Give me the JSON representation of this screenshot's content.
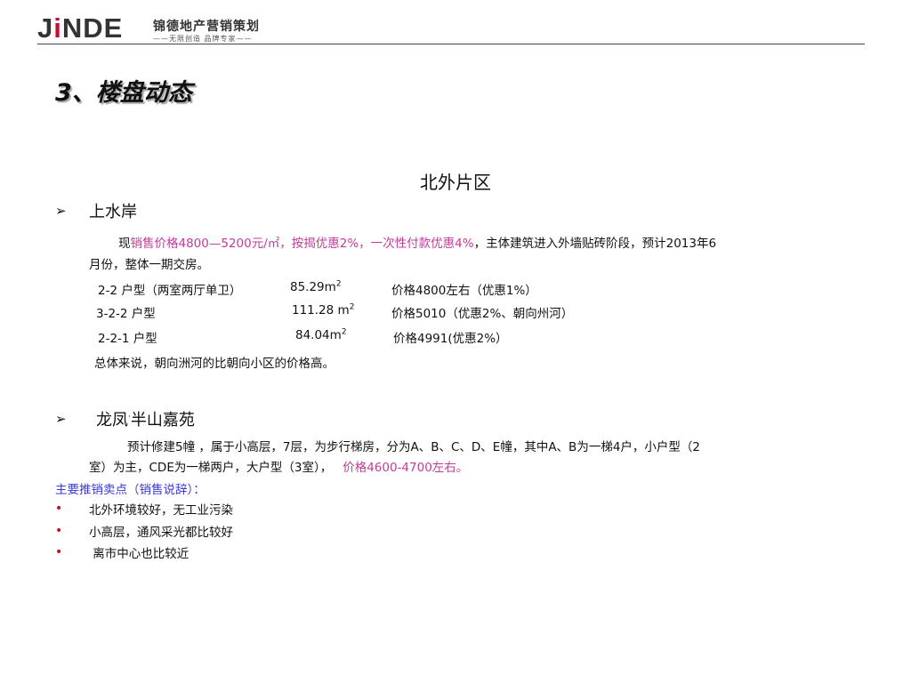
{
  "header": {
    "logo_mark": "JiNDE",
    "logo_cn": "锦德地产营销策划",
    "logo_sub": "——无限创造  品牌专家——"
  },
  "title": "3、楼盘动态",
  "section_heading": "北外片区",
  "project1": {
    "arrow": "➢",
    "name": "上水岸",
    "desc_prefix": "现",
    "desc_highlight": "销售价格4800—5200元/㎡，按揭优惠2%，一次性付款优惠4%",
    "desc_rest_line1": "，主体建筑进入外墙贴砖阶段，预计2013年6",
    "desc_line2": "月份，整体一期交房。",
    "units": [
      {
        "type": "2-2  户型（两室两厅单卫）",
        "area": "85.29m",
        "price": "价格4800左右（优惠1%）"
      },
      {
        "type": "3-2-2 户型",
        "area": "111.28 m",
        "price": "价格5010（优惠2%、朝向州河）"
      },
      {
        "type": "2-2-1 户型",
        "area": "84.04m",
        "price": "价格4991(优惠2%）"
      }
    ],
    "area_sup": "2",
    "summary": "总体来说，朝向洲河的比朝向小区的价格高。"
  },
  "project2": {
    "arrow": "➢",
    "name": "龙凤",
    "name_mid": "·",
    "name_rest": "半山嘉苑",
    "desc_line1": "预计修建5幢 ，属于小高层，7层，为步行梯房，分为A、B、C、D、E幢，其中A、B为一梯4户，小户型（2",
    "desc_line2_a": "室）为主，CDE为一梯两户，大户型（3室），",
    "desc_line2_pink": "价格4600-4700左右。",
    "selling_points_label": "主要推销卖点（销售说辞）：",
    "bullet": "•",
    "points": [
      "北外环境较好，无工业污染",
      "小高层，通风采光都比较好",
      " 离市中心也比较近"
    ]
  },
  "colors": {
    "accent_pink": "#c23c9a",
    "label_blue": "#3a3ad6",
    "bullet_red": "#d0021b",
    "logo_red": "#c8102e"
  }
}
